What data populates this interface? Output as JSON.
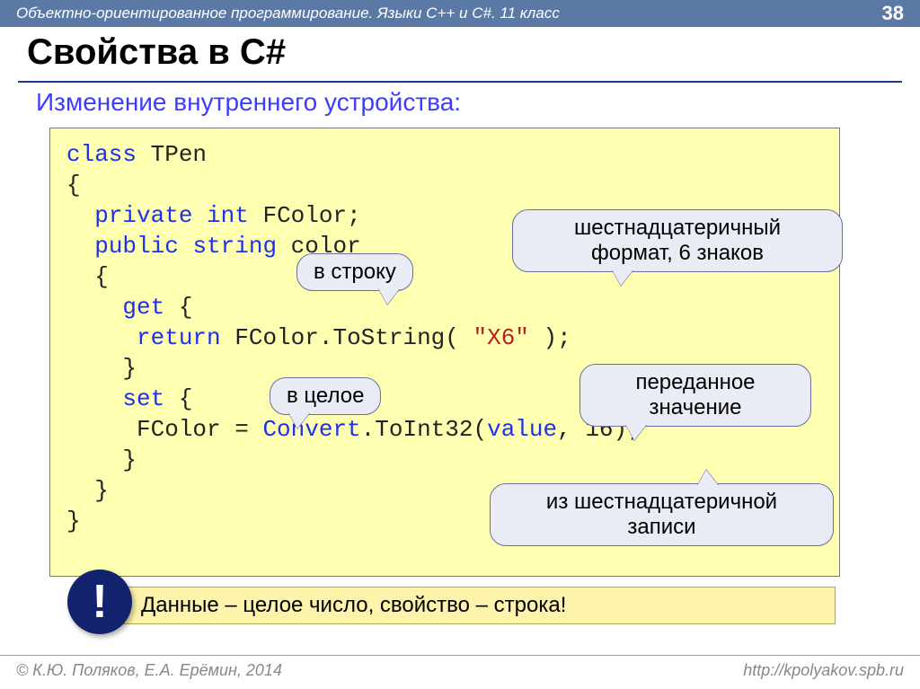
{
  "header": {
    "subject": "Объектно-ориентированное программирование. Языки C++ и C#. 11 класс",
    "page": "38"
  },
  "title": "Свойства в C#",
  "subtitle": "Изменение внутреннего устройства:",
  "code": {
    "l1_kw": "class",
    "l1_name": " TPen",
    "l2": "{",
    "l3_a": "  ",
    "l3_kw1": "private",
    "l3_sp1": " ",
    "l3_kw2": "int",
    "l3_rest": " FColor;",
    "l4_a": "  ",
    "l4_kw1": "public",
    "l4_sp1": " ",
    "l4_kw2": "string",
    "l4_rest": " color",
    "l5": "  {",
    "l6_a": "    ",
    "l6_kw": "get",
    "l6_rest": " {",
    "l7_a": "     ",
    "l7_kw": "return",
    "l7_mid": " FColor.ToString( ",
    "l7_str": "\"X6\"",
    "l7_end": " );",
    "l8": "    }",
    "l9_a": "    ",
    "l9_kw": "set",
    "l9_rest": " {",
    "l10_a": "     FColor = ",
    "l10_conv": "Convert",
    "l10_mid": ".ToInt32(",
    "l10_val": "value",
    "l10_end": ", 16);",
    "l11": "    }",
    "l12": "  }",
    "l13": "}"
  },
  "callouts": {
    "to_string": "в строку",
    "hex_format_1": "шестнадцатеричный",
    "hex_format_2": "формат, 6 знаков",
    "to_int": "в целое",
    "passed_1": "переданное",
    "passed_2": "значение",
    "from_hex_1": "из шестнадцатеричной",
    "from_hex_2": "записи"
  },
  "note": "Данные – целое число, свойство – строка!",
  "exclaim": "!",
  "footer": {
    "left": "© К.Ю. Поляков, Е.А. Ерёмин, 2014",
    "right": "http://kpolyakov.spb.ru"
  }
}
